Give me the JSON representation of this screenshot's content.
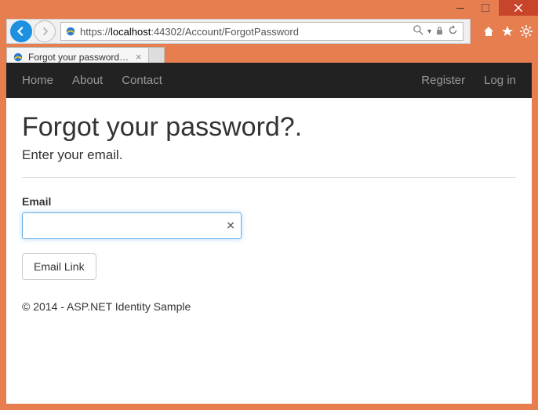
{
  "window": {
    "title": "Forgot your password? - M..."
  },
  "toolbar": {
    "url_prefix": "https://",
    "url_host": "localhost",
    "url_path": ":44302/Account/ForgotPassword"
  },
  "tab": {
    "title": "Forgot your password? - M..."
  },
  "nav": {
    "left": [
      "Home",
      "About",
      "Contact"
    ],
    "right": [
      "Register",
      "Log in"
    ]
  },
  "page": {
    "title": "Forgot your password?.",
    "subtitle": "Enter your email.",
    "emailLabel": "Email",
    "emailValue": "",
    "submit": "Email Link",
    "footer": "© 2014 - ASP.NET Identity Sample"
  }
}
